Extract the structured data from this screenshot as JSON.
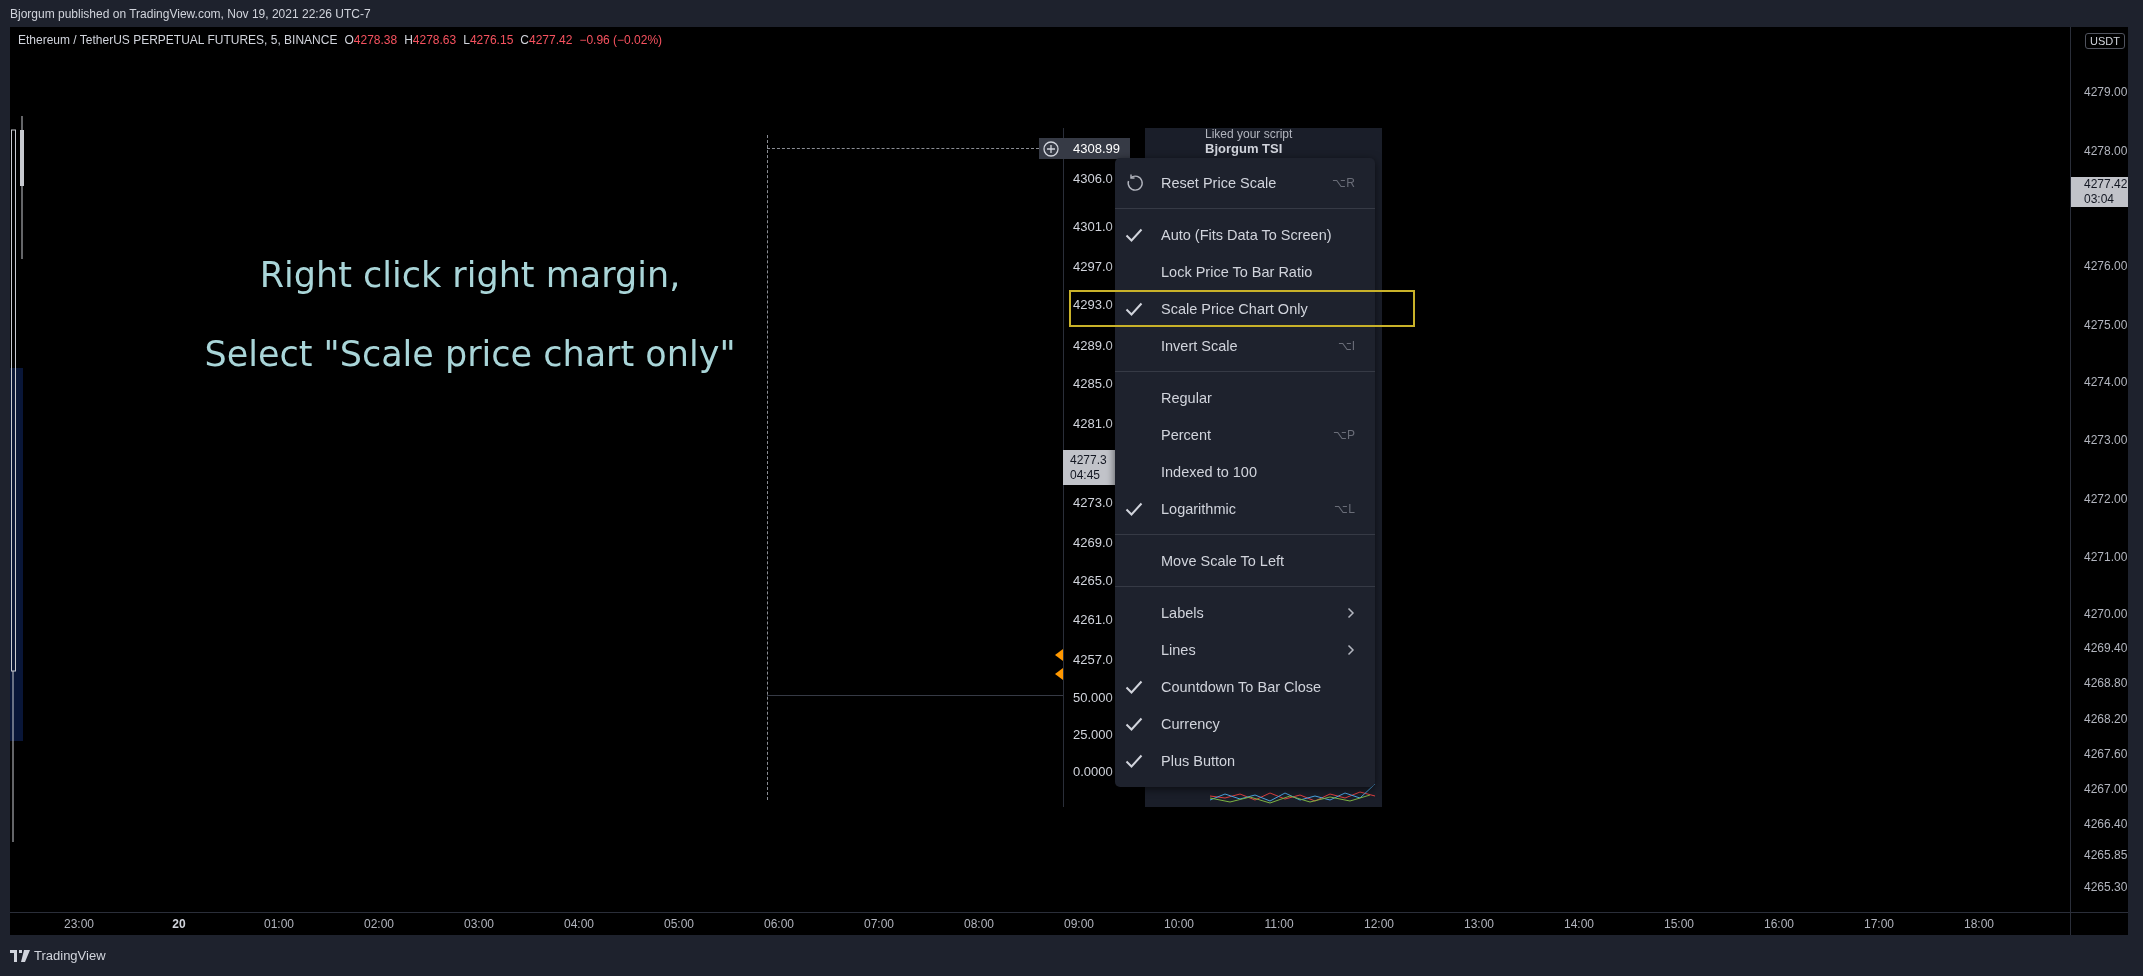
{
  "header": {
    "byline": "Bjorgum published on TradingView.com, Nov 19, 2021 22:26 UTC-7"
  },
  "legend": {
    "symbol": "Ethereum / TetherUS PERPETUAL FUTURES, 5, BINANCE",
    "ohlc": [
      {
        "key": "O",
        "value": "4278.38"
      },
      {
        "key": "H",
        "value": "4278.63"
      },
      {
        "key": "L",
        "value": "4276.15"
      },
      {
        "key": "C",
        "value": "4277.42"
      }
    ],
    "change": "−0.96 (−0.02%)"
  },
  "annotation": {
    "lines": [
      "Right click right margin,",
      "Select \"Scale price chart only\""
    ]
  },
  "inset": {
    "plus_price": "4308.99",
    "axis_labels": [
      "4306.0",
      "4301.0",
      "4297.0",
      "4293.0",
      "4289.0",
      "4285.0",
      "4281.0",
      "4273.0",
      "4269.0",
      "4265.0",
      "4261.0",
      "4257.0",
      "50.000",
      "25.000",
      "0.0000"
    ],
    "last_price": {
      "price": "4277.3",
      "countdown": "04:45"
    },
    "panel_texts": [
      "Liked your script",
      "Bjorgum TSI"
    ],
    "menu": [
      {
        "kind": "action",
        "label": "Reset Price Scale",
        "checked": false,
        "highlighted": false,
        "shortcut": "⌥R"
      },
      {
        "kind": "separator"
      },
      {
        "kind": "item",
        "label": "Auto (Fits Data To Screen)",
        "checked": true,
        "highlighted": false
      },
      {
        "kind": "item",
        "label": "Lock Price To Bar Ratio",
        "checked": false,
        "highlighted": false
      },
      {
        "kind": "item",
        "label": "Scale Price Chart Only",
        "checked": true,
        "highlighted": true
      },
      {
        "kind": "item",
        "label": "Invert Scale",
        "checked": false,
        "highlighted": false,
        "shortcut": "⌥I"
      },
      {
        "kind": "separator"
      },
      {
        "kind": "item",
        "label": "Regular",
        "checked": false,
        "highlighted": false
      },
      {
        "kind": "item",
        "label": "Percent",
        "checked": false,
        "highlighted": false,
        "shortcut": "⌥P"
      },
      {
        "kind": "item",
        "label": "Indexed to 100",
        "checked": false,
        "highlighted": false
      },
      {
        "kind": "item",
        "label": "Logarithmic",
        "checked": true,
        "highlighted": false,
        "shortcut": "⌥L"
      },
      {
        "kind": "separator"
      },
      {
        "kind": "item",
        "label": "Move Scale To Left",
        "checked": false,
        "highlighted": false
      },
      {
        "kind": "separator"
      },
      {
        "kind": "item",
        "label": "Labels",
        "checked": false,
        "highlighted": false,
        "submenu": true
      },
      {
        "kind": "item",
        "label": "Lines",
        "checked": false,
        "highlighted": false,
        "submenu": true
      },
      {
        "kind": "item",
        "label": "Countdown To Bar Close",
        "checked": true,
        "highlighted": false
      },
      {
        "kind": "item",
        "label": "Currency",
        "checked": true,
        "highlighted": false
      },
      {
        "kind": "item",
        "label": "Plus Button",
        "checked": true,
        "highlighted": false
      }
    ]
  },
  "price_axis": {
    "currency": "USDT",
    "labels": [
      "4279.00",
      "4278.00",
      "4276.00",
      "4275.00",
      "4274.00",
      "4273.00",
      "4272.00",
      "4271.00",
      "4270.00",
      "4269.40",
      "4268.80",
      "4268.20",
      "4267.60",
      "4267.00",
      "4266.40",
      "4265.85",
      "4265.30"
    ],
    "last_price": {
      "price": "4277.42",
      "countdown": "03:04"
    }
  },
  "time_axis": {
    "labels": [
      {
        "text": "23:00",
        "bold": false
      },
      {
        "text": "20",
        "bold": true
      },
      {
        "text": "01:00",
        "bold": false
      },
      {
        "text": "02:00",
        "bold": false
      },
      {
        "text": "03:00",
        "bold": false
      },
      {
        "text": "04:00",
        "bold": false
      },
      {
        "text": "05:00",
        "bold": false
      },
      {
        "text": "06:00",
        "bold": false
      },
      {
        "text": "07:00",
        "bold": false
      },
      {
        "text": "08:00",
        "bold": false
      },
      {
        "text": "09:00",
        "bold": false
      },
      {
        "text": "10:00",
        "bold": false
      },
      {
        "text": "11:00",
        "bold": false
      },
      {
        "text": "12:00",
        "bold": false
      },
      {
        "text": "13:00",
        "bold": false
      },
      {
        "text": "14:00",
        "bold": false
      },
      {
        "text": "15:00",
        "bold": false
      },
      {
        "text": "16:00",
        "bold": false
      },
      {
        "text": "17:00",
        "bold": false
      },
      {
        "text": "18:00",
        "bold": false
      }
    ]
  },
  "footer": {
    "brand": "TradingView"
  }
}
